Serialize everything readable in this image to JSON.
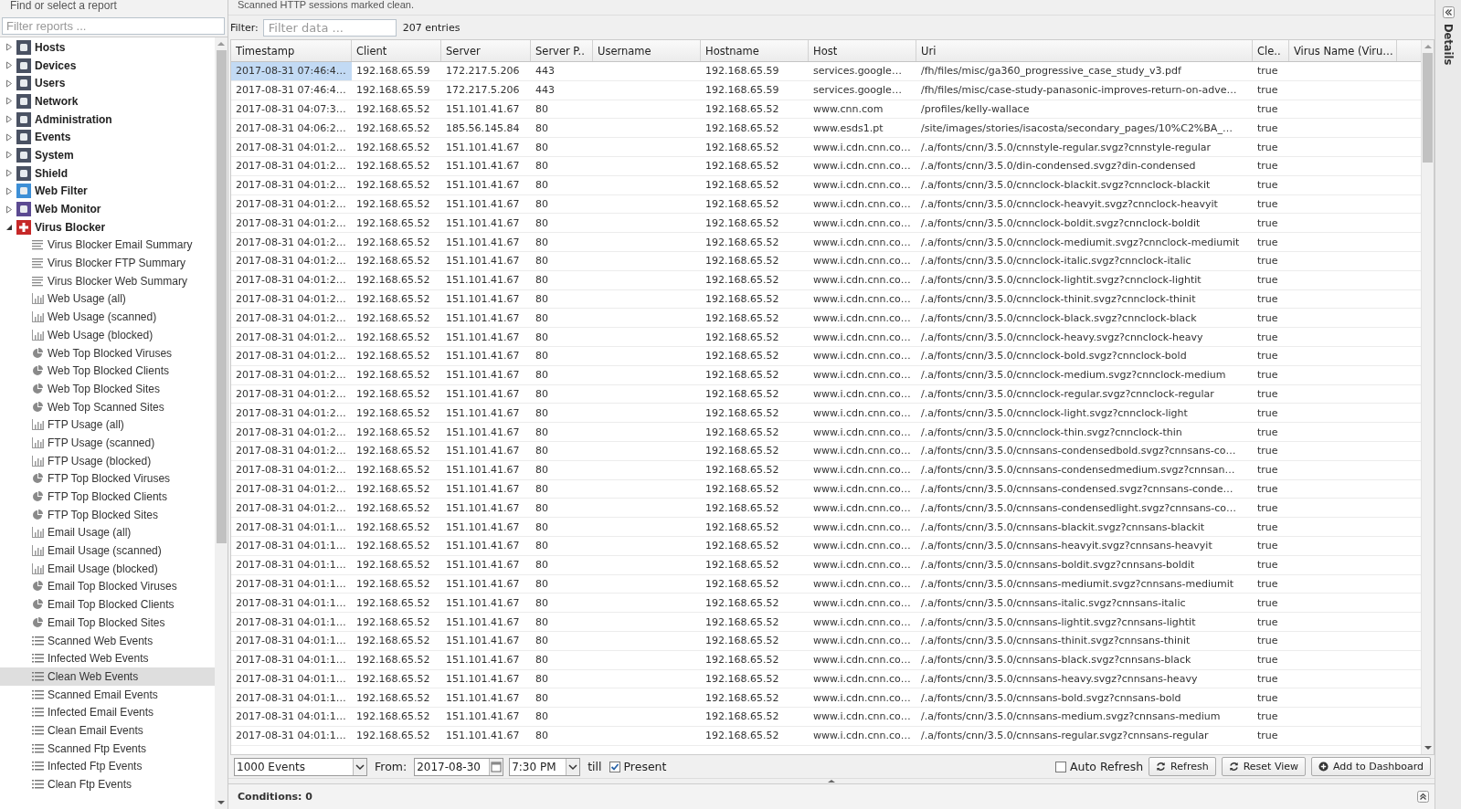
{
  "sidebar": {
    "heading": "Find or select a report",
    "filter": {
      "placeholder": "Filter reports ..."
    },
    "categories": [
      {
        "label": "Hosts",
        "expanded": false
      },
      {
        "label": "Devices",
        "expanded": false
      },
      {
        "label": "Users",
        "expanded": false
      },
      {
        "label": "Network",
        "expanded": false
      },
      {
        "label": "Administration",
        "expanded": false
      },
      {
        "label": "Events",
        "expanded": false
      },
      {
        "label": "System",
        "expanded": false
      },
      {
        "label": "Shield",
        "expanded": false
      },
      {
        "label": "Web Filter",
        "expanded": false
      },
      {
        "label": "Web Monitor",
        "expanded": false
      },
      {
        "label": "Virus Blocker",
        "expanded": true,
        "children": [
          {
            "label": "Virus Blocker Email Summary",
            "kind": "summary",
            "selected": false
          },
          {
            "label": "Virus Blocker FTP Summary",
            "kind": "summary",
            "selected": false
          },
          {
            "label": "Virus Blocker Web Summary",
            "kind": "summary",
            "selected": false
          },
          {
            "label": "Web Usage (all)",
            "kind": "bar",
            "selected": false
          },
          {
            "label": "Web Usage (scanned)",
            "kind": "bar",
            "selected": false
          },
          {
            "label": "Web Usage (blocked)",
            "kind": "bar",
            "selected": false
          },
          {
            "label": "Web Top Blocked Viruses",
            "kind": "pie",
            "selected": false
          },
          {
            "label": "Web Top Blocked Clients",
            "kind": "pie",
            "selected": false
          },
          {
            "label": "Web Top Blocked Sites",
            "kind": "pie",
            "selected": false
          },
          {
            "label": "Web Top Scanned Sites",
            "kind": "pie",
            "selected": false
          },
          {
            "label": "FTP Usage (all)",
            "kind": "bar",
            "selected": false
          },
          {
            "label": "FTP Usage (scanned)",
            "kind": "bar",
            "selected": false
          },
          {
            "label": "FTP Usage (blocked)",
            "kind": "bar",
            "selected": false
          },
          {
            "label": "FTP Top Blocked Viruses",
            "kind": "pie",
            "selected": false
          },
          {
            "label": "FTP Top Blocked Clients",
            "kind": "pie",
            "selected": false
          },
          {
            "label": "FTP Top Blocked Sites",
            "kind": "pie",
            "selected": false
          },
          {
            "label": "Email Usage (all)",
            "kind": "bar",
            "selected": false
          },
          {
            "label": "Email Usage (scanned)",
            "kind": "bar",
            "selected": false
          },
          {
            "label": "Email Usage (blocked)",
            "kind": "bar",
            "selected": false
          },
          {
            "label": "Email Top Blocked Viruses",
            "kind": "pie",
            "selected": false
          },
          {
            "label": "Email Top Blocked Clients",
            "kind": "pie",
            "selected": false
          },
          {
            "label": "Email Top Blocked Sites",
            "kind": "pie",
            "selected": false
          },
          {
            "label": "Scanned Web Events",
            "kind": "events",
            "selected": false
          },
          {
            "label": "Infected Web Events",
            "kind": "events",
            "selected": false
          },
          {
            "label": "Clean Web Events",
            "kind": "events",
            "selected": true
          },
          {
            "label": "Scanned Email Events",
            "kind": "events",
            "selected": false
          },
          {
            "label": "Infected Email Events",
            "kind": "events",
            "selected": false
          },
          {
            "label": "Clean Email Events",
            "kind": "events",
            "selected": false
          },
          {
            "label": "Scanned Ftp Events",
            "kind": "events",
            "selected": false
          },
          {
            "label": "Infected Ftp Events",
            "kind": "events",
            "selected": false
          },
          {
            "label": "Clean Ftp Events",
            "kind": "events",
            "selected": false
          }
        ]
      }
    ]
  },
  "report": {
    "description": "Scanned HTTP sessions marked clean.",
    "filter_label": "Filter:",
    "filter": {
      "placeholder": "Filter data ..."
    },
    "entries": "207 entries"
  },
  "table": {
    "columns": [
      "Timestamp",
      "Client",
      "Server",
      "Server P..",
      "Username",
      "Hostname",
      "Host",
      "Uri",
      "Cle..",
      "Virus Name (Viru…"
    ],
    "rows": [
      {
        "selected": true,
        "cells": [
          "2017-08-31 07:46:4…",
          "192.168.65.59",
          "172.217.5.206",
          "443",
          null,
          "192.168.65.59",
          "services.google…",
          "/fh/files/misc/ga360_progressive_case_study_v3.pdf",
          "true"
        ]
      },
      {
        "selected": false,
        "cells": [
          "2017-08-31 07:46:4…",
          "192.168.65.59",
          "172.217.5.206",
          "443",
          null,
          "192.168.65.59",
          "services.google…",
          "/fh/files/misc/case-study-panasonic-improves-return-on-adve…",
          "true"
        ]
      },
      {
        "selected": false,
        "cells": [
          "2017-08-31 04:07:3…",
          "192.168.65.52",
          "151.101.41.67",
          "80",
          null,
          "192.168.65.52",
          "www.cnn.com",
          "/profiles/kelly-wallace",
          "true"
        ]
      },
      {
        "selected": false,
        "cells": [
          "2017-08-31 04:06:2…",
          "192.168.65.52",
          "185.56.145.84",
          "80",
          null,
          "192.168.65.52",
          "www.esds1.pt",
          "/site/images/stories/isacosta/secondary_pages/10%C2%BA_…",
          "true"
        ]
      },
      {
        "selected": false,
        "cells": [
          "2017-08-31 04:01:2…",
          "192.168.65.52",
          "151.101.41.67",
          "80",
          null,
          "192.168.65.52",
          "www.i.cdn.cnn.co…",
          "/.a/fonts/cnn/3.5.0/cnnstyle-regular.svgz?cnnstyle-regular",
          "true"
        ]
      },
      {
        "selected": false,
        "cells": [
          "2017-08-31 04:01:2…",
          "192.168.65.52",
          "151.101.41.67",
          "80",
          null,
          "192.168.65.52",
          "www.i.cdn.cnn.co…",
          "/.a/fonts/cnn/3.5.0/din-condensed.svgz?din-condensed",
          "true"
        ]
      },
      {
        "selected": false,
        "cells": [
          "2017-08-31 04:01:2…",
          "192.168.65.52",
          "151.101.41.67",
          "80",
          null,
          "192.168.65.52",
          "www.i.cdn.cnn.co…",
          "/.a/fonts/cnn/3.5.0/cnnclock-blackit.svgz?cnnclock-blackit",
          "true"
        ]
      },
      {
        "selected": false,
        "cells": [
          "2017-08-31 04:01:2…",
          "192.168.65.52",
          "151.101.41.67",
          "80",
          null,
          "192.168.65.52",
          "www.i.cdn.cnn.co…",
          "/.a/fonts/cnn/3.5.0/cnnclock-heavyit.svgz?cnnclock-heavyit",
          "true"
        ]
      },
      {
        "selected": false,
        "cells": [
          "2017-08-31 04:01:2…",
          "192.168.65.52",
          "151.101.41.67",
          "80",
          null,
          "192.168.65.52",
          "www.i.cdn.cnn.co…",
          "/.a/fonts/cnn/3.5.0/cnnclock-boldit.svgz?cnnclock-boldit",
          "true"
        ]
      },
      {
        "selected": false,
        "cells": [
          "2017-08-31 04:01:2…",
          "192.168.65.52",
          "151.101.41.67",
          "80",
          null,
          "192.168.65.52",
          "www.i.cdn.cnn.co…",
          "/.a/fonts/cnn/3.5.0/cnnclock-mediumit.svgz?cnnclock-mediumit",
          "true"
        ]
      },
      {
        "selected": false,
        "cells": [
          "2017-08-31 04:01:2…",
          "192.168.65.52",
          "151.101.41.67",
          "80",
          null,
          "192.168.65.52",
          "www.i.cdn.cnn.co…",
          "/.a/fonts/cnn/3.5.0/cnnclock-italic.svgz?cnnclock-italic",
          "true"
        ]
      },
      {
        "selected": false,
        "cells": [
          "2017-08-31 04:01:2…",
          "192.168.65.52",
          "151.101.41.67",
          "80",
          null,
          "192.168.65.52",
          "www.i.cdn.cnn.co…",
          "/.a/fonts/cnn/3.5.0/cnnclock-lightit.svgz?cnnclock-lightit",
          "true"
        ]
      },
      {
        "selected": false,
        "cells": [
          "2017-08-31 04:01:2…",
          "192.168.65.52",
          "151.101.41.67",
          "80",
          null,
          "192.168.65.52",
          "www.i.cdn.cnn.co…",
          "/.a/fonts/cnn/3.5.0/cnnclock-thinit.svgz?cnnclock-thinit",
          "true"
        ]
      },
      {
        "selected": false,
        "cells": [
          "2017-08-31 04:01:2…",
          "192.168.65.52",
          "151.101.41.67",
          "80",
          null,
          "192.168.65.52",
          "www.i.cdn.cnn.co…",
          "/.a/fonts/cnn/3.5.0/cnnclock-black.svgz?cnnclock-black",
          "true"
        ]
      },
      {
        "selected": false,
        "cells": [
          "2017-08-31 04:01:2…",
          "192.168.65.52",
          "151.101.41.67",
          "80",
          null,
          "192.168.65.52",
          "www.i.cdn.cnn.co…",
          "/.a/fonts/cnn/3.5.0/cnnclock-heavy.svgz?cnnclock-heavy",
          "true"
        ]
      },
      {
        "selected": false,
        "cells": [
          "2017-08-31 04:01:2…",
          "192.168.65.52",
          "151.101.41.67",
          "80",
          null,
          "192.168.65.52",
          "www.i.cdn.cnn.co…",
          "/.a/fonts/cnn/3.5.0/cnnclock-bold.svgz?cnnclock-bold",
          "true"
        ]
      },
      {
        "selected": false,
        "cells": [
          "2017-08-31 04:01:2…",
          "192.168.65.52",
          "151.101.41.67",
          "80",
          null,
          "192.168.65.52",
          "www.i.cdn.cnn.co…",
          "/.a/fonts/cnn/3.5.0/cnnclock-medium.svgz?cnnclock-medium",
          "true"
        ]
      },
      {
        "selected": false,
        "cells": [
          "2017-08-31 04:01:2…",
          "192.168.65.52",
          "151.101.41.67",
          "80",
          null,
          "192.168.65.52",
          "www.i.cdn.cnn.co…",
          "/.a/fonts/cnn/3.5.0/cnnclock-regular.svgz?cnnclock-regular",
          "true"
        ]
      },
      {
        "selected": false,
        "cells": [
          "2017-08-31 04:01:2…",
          "192.168.65.52",
          "151.101.41.67",
          "80",
          null,
          "192.168.65.52",
          "www.i.cdn.cnn.co…",
          "/.a/fonts/cnn/3.5.0/cnnclock-light.svgz?cnnclock-light",
          "true"
        ]
      },
      {
        "selected": false,
        "cells": [
          "2017-08-31 04:01:2…",
          "192.168.65.52",
          "151.101.41.67",
          "80",
          null,
          "192.168.65.52",
          "www.i.cdn.cnn.co…",
          "/.a/fonts/cnn/3.5.0/cnnclock-thin.svgz?cnnclock-thin",
          "true"
        ]
      },
      {
        "selected": false,
        "cells": [
          "2017-08-31 04:01:2…",
          "192.168.65.52",
          "151.101.41.67",
          "80",
          null,
          "192.168.65.52",
          "www.i.cdn.cnn.co…",
          "/.a/fonts/cnn/3.5.0/cnnsans-condensedbold.svgz?cnnsans-co…",
          "true"
        ]
      },
      {
        "selected": false,
        "cells": [
          "2017-08-31 04:01:2…",
          "192.168.65.52",
          "151.101.41.67",
          "80",
          null,
          "192.168.65.52",
          "www.i.cdn.cnn.co…",
          "/.a/fonts/cnn/3.5.0/cnnsans-condensedmedium.svgz?cnnsan…",
          "true"
        ]
      },
      {
        "selected": false,
        "cells": [
          "2017-08-31 04:01:2…",
          "192.168.65.52",
          "151.101.41.67",
          "80",
          null,
          "192.168.65.52",
          "www.i.cdn.cnn.co…",
          "/.a/fonts/cnn/3.5.0/cnnsans-condensed.svgz?cnnsans-conde…",
          "true"
        ]
      },
      {
        "selected": false,
        "cells": [
          "2017-08-31 04:01:2…",
          "192.168.65.52",
          "151.101.41.67",
          "80",
          null,
          "192.168.65.52",
          "www.i.cdn.cnn.co…",
          "/.a/fonts/cnn/3.5.0/cnnsans-condensedlight.svgz?cnnsans-co…",
          "true"
        ]
      },
      {
        "selected": false,
        "cells": [
          "2017-08-31 04:01:1…",
          "192.168.65.52",
          "151.101.41.67",
          "80",
          null,
          "192.168.65.52",
          "www.i.cdn.cnn.co…",
          "/.a/fonts/cnn/3.5.0/cnnsans-blackit.svgz?cnnsans-blackit",
          "true"
        ]
      },
      {
        "selected": false,
        "cells": [
          "2017-08-31 04:01:1…",
          "192.168.65.52",
          "151.101.41.67",
          "80",
          null,
          "192.168.65.52",
          "www.i.cdn.cnn.co…",
          "/.a/fonts/cnn/3.5.0/cnnsans-heavyit.svgz?cnnsans-heavyit",
          "true"
        ]
      },
      {
        "selected": false,
        "cells": [
          "2017-08-31 04:01:1…",
          "192.168.65.52",
          "151.101.41.67",
          "80",
          null,
          "192.168.65.52",
          "www.i.cdn.cnn.co…",
          "/.a/fonts/cnn/3.5.0/cnnsans-boldit.svgz?cnnsans-boldit",
          "true"
        ]
      },
      {
        "selected": false,
        "cells": [
          "2017-08-31 04:01:1…",
          "192.168.65.52",
          "151.101.41.67",
          "80",
          null,
          "192.168.65.52",
          "www.i.cdn.cnn.co…",
          "/.a/fonts/cnn/3.5.0/cnnsans-mediumit.svgz?cnnsans-mediumit",
          "true"
        ]
      },
      {
        "selected": false,
        "cells": [
          "2017-08-31 04:01:1…",
          "192.168.65.52",
          "151.101.41.67",
          "80",
          null,
          "192.168.65.52",
          "www.i.cdn.cnn.co…",
          "/.a/fonts/cnn/3.5.0/cnnsans-italic.svgz?cnnsans-italic",
          "true"
        ]
      },
      {
        "selected": false,
        "cells": [
          "2017-08-31 04:01:1…",
          "192.168.65.52",
          "151.101.41.67",
          "80",
          null,
          "192.168.65.52",
          "www.i.cdn.cnn.co…",
          "/.a/fonts/cnn/3.5.0/cnnsans-lightit.svgz?cnnsans-lightit",
          "true"
        ]
      },
      {
        "selected": false,
        "cells": [
          "2017-08-31 04:01:1…",
          "192.168.65.52",
          "151.101.41.67",
          "80",
          null,
          "192.168.65.52",
          "www.i.cdn.cnn.co…",
          "/.a/fonts/cnn/3.5.0/cnnsans-thinit.svgz?cnnsans-thinit",
          "true"
        ]
      },
      {
        "selected": false,
        "cells": [
          "2017-08-31 04:01:1…",
          "192.168.65.52",
          "151.101.41.67",
          "80",
          null,
          "192.168.65.52",
          "www.i.cdn.cnn.co…",
          "/.a/fonts/cnn/3.5.0/cnnsans-black.svgz?cnnsans-black",
          "true"
        ]
      },
      {
        "selected": false,
        "cells": [
          "2017-08-31 04:01:1…",
          "192.168.65.52",
          "151.101.41.67",
          "80",
          null,
          "192.168.65.52",
          "www.i.cdn.cnn.co…",
          "/.a/fonts/cnn/3.5.0/cnnsans-heavy.svgz?cnnsans-heavy",
          "true"
        ]
      },
      {
        "selected": false,
        "cells": [
          "2017-08-31 04:01:1…",
          "192.168.65.52",
          "151.101.41.67",
          "80",
          null,
          "192.168.65.52",
          "www.i.cdn.cnn.co…",
          "/.a/fonts/cnn/3.5.0/cnnsans-bold.svgz?cnnsans-bold",
          "true"
        ]
      },
      {
        "selected": false,
        "cells": [
          "2017-08-31 04:01:1…",
          "192.168.65.52",
          "151.101.41.67",
          "80",
          null,
          "192.168.65.52",
          "www.i.cdn.cnn.co…",
          "/.a/fonts/cnn/3.5.0/cnnsans-medium.svgz?cnnsans-medium",
          "true"
        ]
      },
      {
        "selected": false,
        "cells": [
          "2017-08-31 04:01:1…",
          "192.168.65.52",
          "151.101.41.67",
          "80",
          null,
          "192.168.65.52",
          "www.i.cdn.cnn.co…",
          "/.a/fonts/cnn/3.5.0/cnnsans-regular.svgz?cnnsans-regular",
          "true"
        ]
      }
    ]
  },
  "toolbar": {
    "limit": "1000 Events",
    "from_label": "From:",
    "date": "2017-08-30",
    "time": "7:30 PM",
    "till_label": "till",
    "present": {
      "label": "Present",
      "checked": true
    },
    "auto_refresh": {
      "label": "Auto Refresh",
      "checked": false
    },
    "buttons": [
      "Refresh",
      "Reset View",
      "Add to Dashboard"
    ]
  },
  "conditions": "Conditions: 0",
  "details_panel": {
    "label": "Details"
  }
}
